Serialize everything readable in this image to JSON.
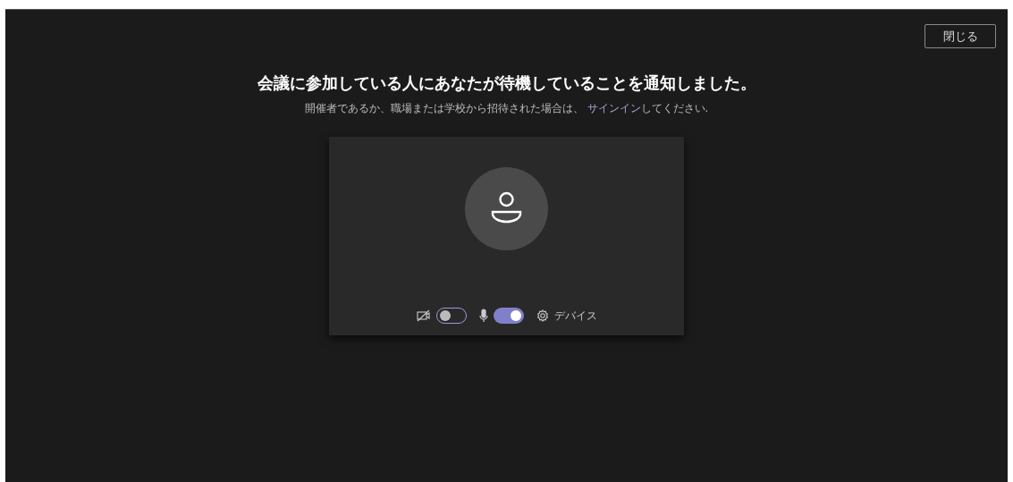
{
  "close_button": "閉じる",
  "title": "会議に参加している人にあなたが待機していることを通知しました。",
  "subtitle": {
    "before": "開催者であるか、職場または学校から招待された場合は、",
    "link": "サインイン",
    "after": "してください."
  },
  "controls": [
    {
      "kind": "camera",
      "on": false
    },
    {
      "kind": "microphone",
      "on": true
    },
    {
      "kind": "devices",
      "label": "デバイス"
    }
  ]
}
